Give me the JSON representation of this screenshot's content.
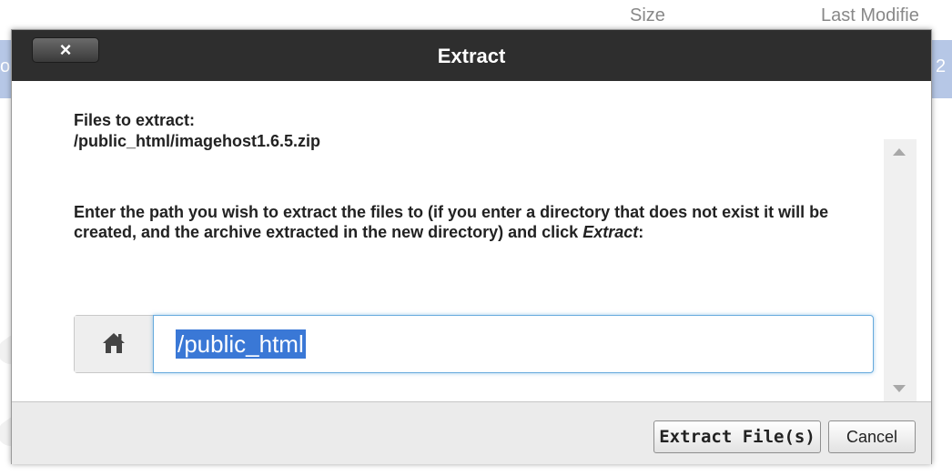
{
  "background": {
    "columns": [
      "Size",
      "Last Modifie"
    ],
    "row_left_fragment": "o",
    "row_right_fragment": "2"
  },
  "dialog": {
    "title": "Extract",
    "close_label": "×",
    "files_label": "Files to extract:",
    "files_path": "/public_html/imagehost1.6.5.zip",
    "instructions_main": "Enter the path you wish to extract the files to (if you enter a directory that does not exist it will be created, and the archive extracted in the new directory) and click ",
    "instructions_em": "Extract",
    "instructions_end": ":",
    "path_value": "/public_html",
    "extract_button": "Extract File(s)",
    "cancel_button": "Cancel"
  },
  "colors": {
    "titlebar": "#2e2e2e",
    "selection": "#3a78d6",
    "background_row": "#b6c7e6",
    "input_focus": "#66aadd"
  },
  "icons": {
    "close": "close-icon",
    "home": "home-icon",
    "scroll_up": "arrow-up-icon",
    "scroll_down": "arrow-down-icon"
  }
}
